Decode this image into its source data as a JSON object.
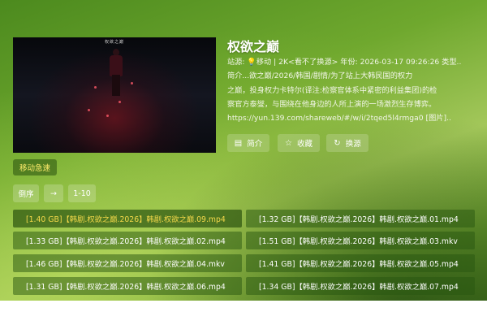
{
  "detail": {
    "title": "权欲之巅",
    "meta_prefix": "站源: ",
    "meta_rest": "移动 | 2K<看不了换源> 年份: 2026-03-17 09:26:26 类型..",
    "desc_line1": "简介...欲之巅/2026/韩国/剧情/为了站上大韩民国的权力",
    "desc_line2": "之巅，投身权力卡特尔(译注:检察官体系中紧密的利益集团)的检",
    "desc_line3": "察官方泰燮，与围绕在他身边的人所上演的一场激烈生存博弈。",
    "link": "https://yun.139.com/shareweb/#/w/i/2tqed5l4rmga0 [图片]..",
    "thumb_title": "权欲之巅"
  },
  "actions": {
    "intro_label": "简介",
    "fav_label": "收藏",
    "switch_label": "换源"
  },
  "source": {
    "label": "移动急速"
  },
  "sort": {
    "order_label": "倒序",
    "arrow_label": "→",
    "range_label": "1-10"
  },
  "episodes": [
    "[1.40 GB]【韩剧.权欲之巅.2026】韩剧.权欲之巅.09.mp4",
    "[1.32 GB]【韩剧.权欲之巅.2026】韩剧.权欲之巅.01.mp4",
    "[1.33 GB]【韩剧.权欲之巅.2026】韩剧.权欲之巅.02.mp4",
    "[1.51 GB]【韩剧.权欲之巅.2026】韩剧.权欲之巅.03.mkv",
    "[1.46 GB]【韩剧.权欲之巅.2026】韩剧.权欲之巅.04.mkv",
    "[1.41 GB]【韩剧.权欲之巅.2026】韩剧.权欲之巅.05.mp4",
    "[1.31 GB]【韩剧.权欲之巅.2026】韩剧.权欲之巅.06.mp4",
    "[1.34 GB]【韩剧.权欲之巅.2026】韩剧.权欲之巅.07.mp4"
  ],
  "icons": {
    "bulb": "lightbulb-icon",
    "intro": "document-icon",
    "fav": "star-icon",
    "switch": "refresh-icon"
  },
  "colors": {
    "active_episode_text": "#f5d94a",
    "source_text": "#fbe96a"
  }
}
